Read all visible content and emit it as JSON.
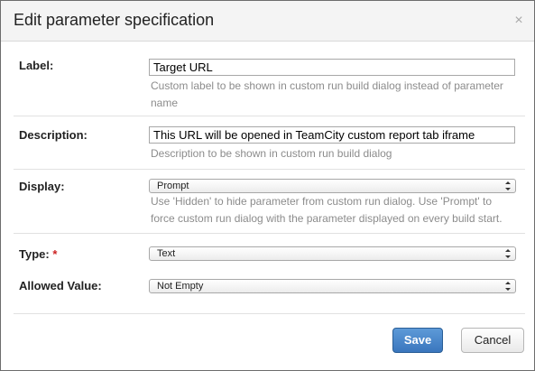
{
  "dialog": {
    "title": "Edit parameter specification",
    "close_glyph": "×"
  },
  "fields": {
    "label": {
      "label": "Label:",
      "value": "Target URL",
      "hint": "Custom label to be shown in custom run build dialog instead of parameter name"
    },
    "description": {
      "label": "Description:",
      "value": "This URL will be opened in TeamCity custom report tab iframe",
      "hint": "Description to be shown in custom run build dialog"
    },
    "display": {
      "label": "Display:",
      "selected": "Prompt",
      "hint": "Use 'Hidden' to hide parameter from custom run dialog. Use 'Prompt' to force custom run dialog with the parameter displayed on every build start."
    },
    "type": {
      "label": "Type:",
      "required_mark": "*",
      "selected": "Text"
    },
    "allowed_value": {
      "label": "Allowed Value:",
      "selected": "Not Empty"
    }
  },
  "buttons": {
    "save": "Save",
    "cancel": "Cancel"
  },
  "icons": {
    "close": "close-icon",
    "select_arrows": "updown-arrows-icon"
  },
  "colors": {
    "primary_button": "#3f7cc2",
    "required": "#cc2222",
    "hint_text": "#8c8c8c"
  }
}
